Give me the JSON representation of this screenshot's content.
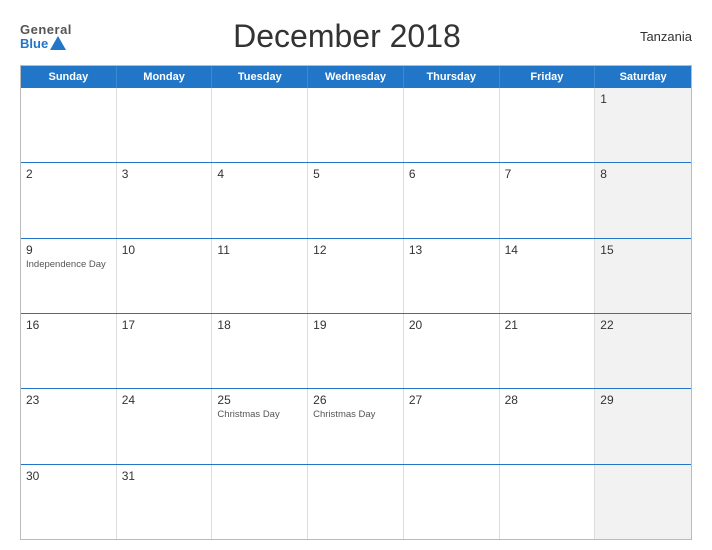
{
  "header": {
    "logo_general": "General",
    "logo_blue": "Blue",
    "title": "December 2018",
    "country": "Tanzania"
  },
  "weekdays": [
    "Sunday",
    "Monday",
    "Tuesday",
    "Wednesday",
    "Thursday",
    "Friday",
    "Saturday"
  ],
  "rows": [
    [
      {
        "num": "",
        "shaded": false
      },
      {
        "num": "",
        "shaded": false
      },
      {
        "num": "",
        "shaded": false
      },
      {
        "num": "",
        "shaded": false
      },
      {
        "num": "",
        "shaded": false
      },
      {
        "num": "",
        "shaded": false
      },
      {
        "num": "1",
        "shaded": true
      }
    ],
    [
      {
        "num": "2",
        "shaded": false
      },
      {
        "num": "3",
        "shaded": false
      },
      {
        "num": "4",
        "shaded": false
      },
      {
        "num": "5",
        "shaded": false
      },
      {
        "num": "6",
        "shaded": false
      },
      {
        "num": "7",
        "shaded": false
      },
      {
        "num": "8",
        "shaded": true
      }
    ],
    [
      {
        "num": "9",
        "shaded": false,
        "event": "Independence Day"
      },
      {
        "num": "10",
        "shaded": false
      },
      {
        "num": "11",
        "shaded": false
      },
      {
        "num": "12",
        "shaded": false
      },
      {
        "num": "13",
        "shaded": false
      },
      {
        "num": "14",
        "shaded": false
      },
      {
        "num": "15",
        "shaded": true
      }
    ],
    [
      {
        "num": "16",
        "shaded": false
      },
      {
        "num": "17",
        "shaded": false
      },
      {
        "num": "18",
        "shaded": false
      },
      {
        "num": "19",
        "shaded": false
      },
      {
        "num": "20",
        "shaded": false
      },
      {
        "num": "21",
        "shaded": false
      },
      {
        "num": "22",
        "shaded": true
      }
    ],
    [
      {
        "num": "23",
        "shaded": false
      },
      {
        "num": "24",
        "shaded": false
      },
      {
        "num": "25",
        "shaded": false,
        "event": "Christmas Day"
      },
      {
        "num": "26",
        "shaded": false,
        "event": "Christmas Day"
      },
      {
        "num": "27",
        "shaded": false
      },
      {
        "num": "28",
        "shaded": false
      },
      {
        "num": "29",
        "shaded": true
      }
    ],
    [
      {
        "num": "30",
        "shaded": false
      },
      {
        "num": "31",
        "shaded": false
      },
      {
        "num": "",
        "shaded": false
      },
      {
        "num": "",
        "shaded": false
      },
      {
        "num": "",
        "shaded": false
      },
      {
        "num": "",
        "shaded": false
      },
      {
        "num": "",
        "shaded": true
      }
    ]
  ]
}
